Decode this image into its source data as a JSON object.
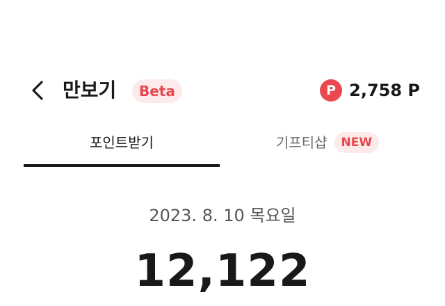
{
  "header": {
    "title": "만보기",
    "beta_label": "Beta",
    "point_icon": "P",
    "point_value": "2,758 P"
  },
  "tabs": [
    {
      "label": "포인트받기",
      "active": true
    },
    {
      "label": "기프티샵",
      "badge": "NEW",
      "active": false
    }
  ],
  "main": {
    "date": "2023. 8. 10 목요일",
    "steps": "12,122"
  },
  "colors": {
    "accent": "#e9484e",
    "badge_bg": "#fdebec",
    "text": "#191919"
  }
}
